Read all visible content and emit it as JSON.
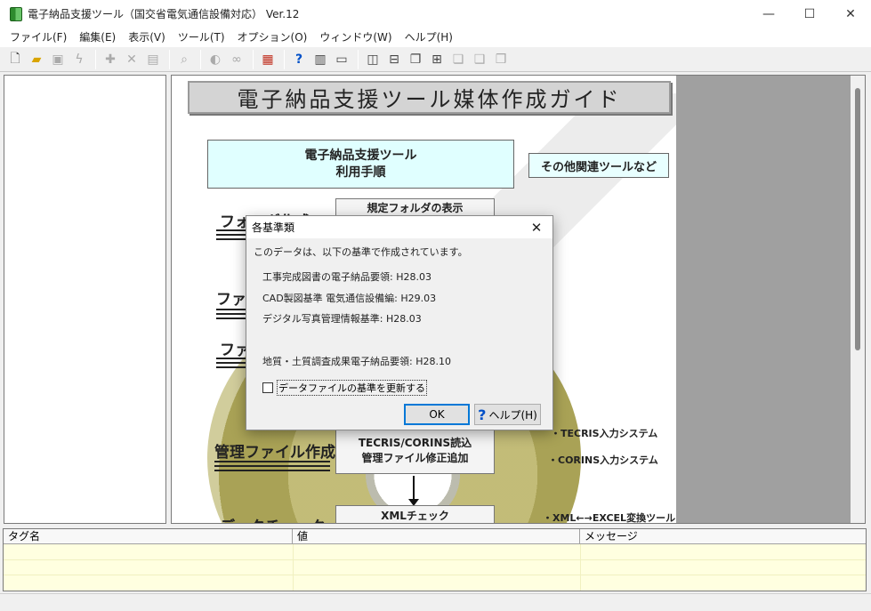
{
  "window": {
    "title": "電子納品支援ツール（国交省電気通信設備対応） Ver.12",
    "minimize": "—",
    "maximize": "☐",
    "close": "✕"
  },
  "menu": [
    "ファイル(F)",
    "編集(E)",
    "表示(V)",
    "ツール(T)",
    "オプション(O)",
    "ウィンドウ(W)",
    "ヘルプ(H)"
  ],
  "toolbar": {
    "icons": [
      "new-icon",
      "open-icon",
      "save-icon",
      "lightning-icon",
      "add-icon",
      "delete-icon",
      "properties-icon",
      "preview-icon",
      "stamp-icon",
      "binoculars-icon",
      "color-icon",
      "help-icon",
      "book-icon",
      "card-icon",
      "layout-icon",
      "layout-icon",
      "layout-icon",
      "layout-icon",
      "layout-icon",
      "layout-icon",
      "layout-icon"
    ]
  },
  "guide": {
    "title": "電子納品支援ツール媒体作成ガイド",
    "procedure_line1": "電子納品支援ツール",
    "procedure_line2": "利用手順",
    "other_tools": "その他関連ツールなど",
    "step_folder": "フォルダ作成",
    "step_folder_box": "規定フォルダの表示",
    "step_file1": "ファ",
    "step_file2": "ファ",
    "step_manage": "管理ファイル作成",
    "manage_box_line1": "TECRIS/CORINS読込",
    "manage_box_line2": "管理ファイル修正追加",
    "step_check": "データチェック",
    "xml_check": "XMLチェック",
    "note_tecris": "・TECRIS入力システム",
    "note_corins": "・CORINS入力システム",
    "note_xml": "・XML←→EXCEL変換ツール"
  },
  "dialog": {
    "title": "各基準類",
    "intro": "このデータは、以下の基準で作成されています。",
    "standard1": "工事完成図書の電子納品要領: H28.03",
    "standard2": "CAD製図基準 電気通信設備編: H29.03",
    "standard3": "デジタル写真管理情報基準: H28.03",
    "standard4": "地質・土質調査成果電子納品要領: H28.10",
    "checkbox_label": "データファイルの基準を更新する",
    "ok_label": "OK",
    "help_label": "ヘルプ(H)"
  },
  "bottom": {
    "columns": [
      "タグ名",
      "値",
      "メッセージ"
    ]
  }
}
